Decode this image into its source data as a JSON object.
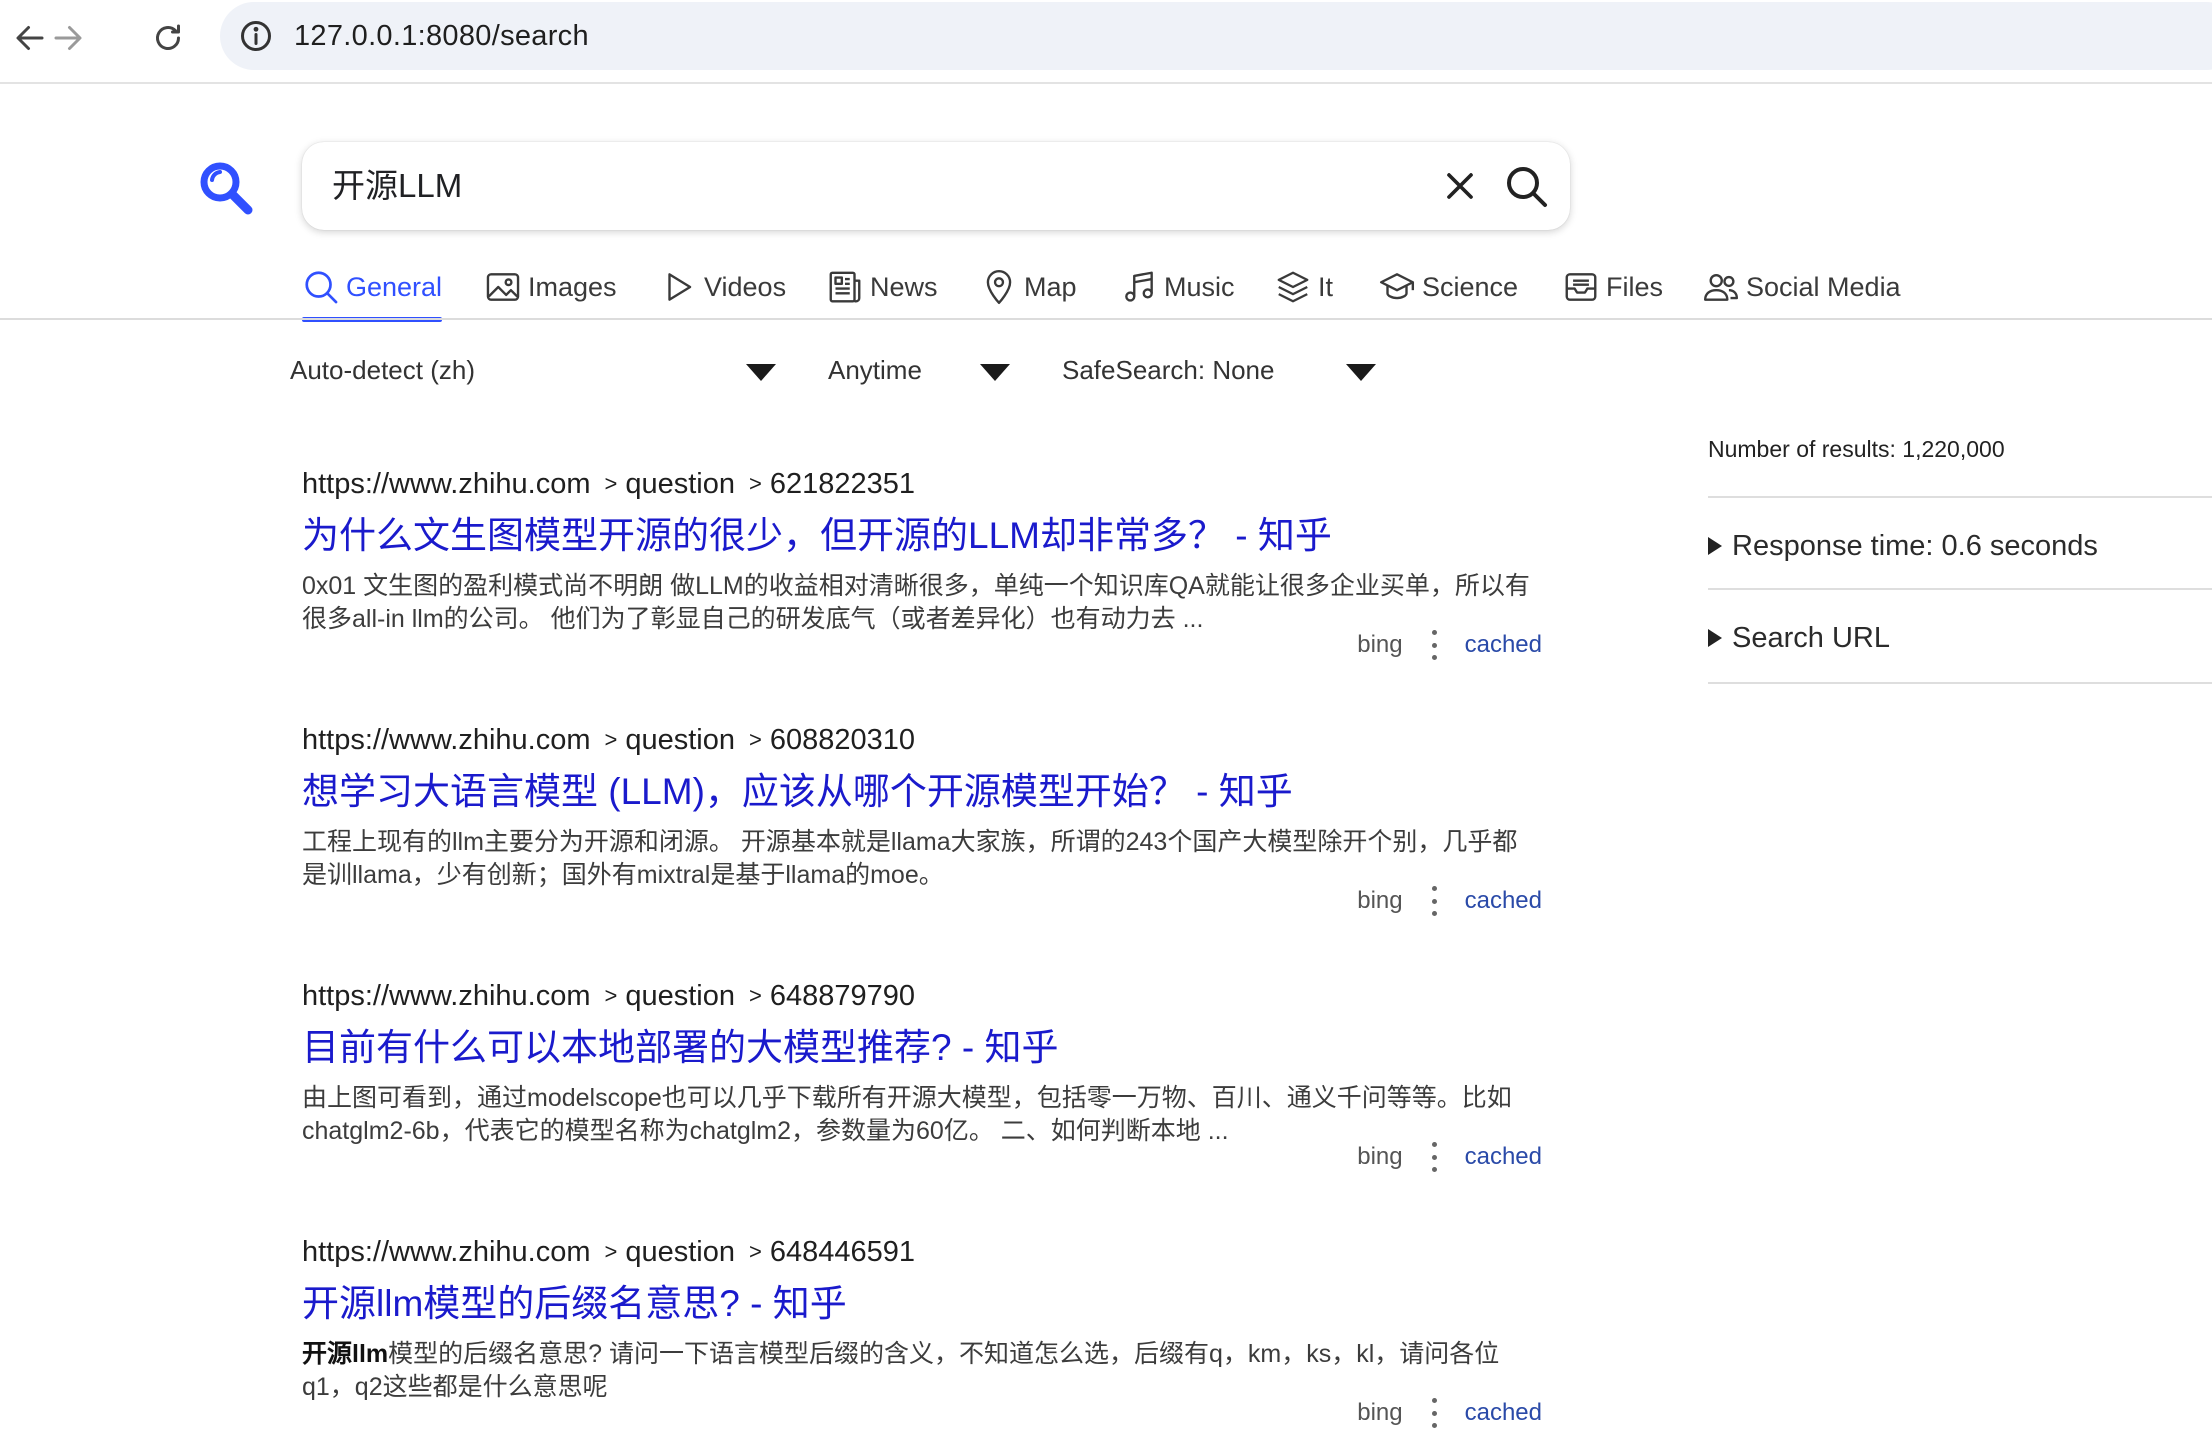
{
  "browser": {
    "url": "127.0.0.1:8080/search"
  },
  "search": {
    "query": "开源LLM"
  },
  "tabs": [
    {
      "label": "General",
      "icon": "search-icon",
      "active": true
    },
    {
      "label": "Images",
      "icon": "image-icon"
    },
    {
      "label": "Videos",
      "icon": "play-icon"
    },
    {
      "label": "News",
      "icon": "newspaper-icon"
    },
    {
      "label": "Map",
      "icon": "map-pin-icon"
    },
    {
      "label": "Music",
      "icon": "music-note-icon"
    },
    {
      "label": "It",
      "icon": "layers-icon"
    },
    {
      "label": "Science",
      "icon": "graduation-cap-icon"
    },
    {
      "label": "Files",
      "icon": "inbox-icon"
    },
    {
      "label": "Social Media",
      "icon": "people-icon"
    }
  ],
  "filters": {
    "language": "Auto-detect (zh)",
    "time": "Anytime",
    "safesearch": "SafeSearch: None"
  },
  "results": [
    {
      "host": "https://www.zhihu.com",
      "path1": "question",
      "path2": "621822351",
      "title": "为什么文生图模型开源的很少，但开源的LLM却非常多？ - 知乎",
      "snippet_bold": "",
      "snippet": "0x01 文生图的盈利模式尚不明朗 做LLM的收益相对清晰很多，单纯一个知识库QA就能让很多企业买单，所以有很多all-in llm的公司。 他们为了彰显自己的研发底气（或者差异化）也有动力去 ...",
      "engine": "bing",
      "cached": "cached"
    },
    {
      "host": "https://www.zhihu.com",
      "path1": "question",
      "path2": "608820310",
      "title": "想学习大语言模型 (LLM)，应该从哪个开源模型开始？ - 知乎",
      "snippet_bold": "",
      "snippet": "工程上现有的llm主要分为开源和闭源。 开源基本就是llama大家族，所谓的243个国产大模型除开个别，几乎都是训llama，少有创新；国外有mixtral是基于llama的moe。",
      "engine": "bing",
      "cached": "cached"
    },
    {
      "host": "https://www.zhihu.com",
      "path1": "question",
      "path2": "648879790",
      "title": "目前有什么可以本地部署的大模型推荐? - 知乎",
      "snippet_bold": "",
      "snippet": "由上图可看到，通过modelscope也可以几乎下载所有开源大模型，包括零一万物、百川、通义千问等等。比如chatglm2-6b，代表它的模型名称为chatglm2，参数量为60亿。 二、如何判断本地 ...",
      "engine": "bing",
      "cached": "cached"
    },
    {
      "host": "https://www.zhihu.com",
      "path1": "question",
      "path2": "648446591",
      "title": "开源llm模型的后缀名意思? - 知乎",
      "snippet_bold": "开源llm",
      "snippet": "模型的后缀名意思? 请问一下语言模型后缀的含义，不知道怎么选，后缀有q，km，ks，kl，请问各位q1，q2这些都是什么意思呢",
      "engine": "bing",
      "cached": "cached"
    }
  ],
  "sidebar": {
    "results_count": "Number of results: 1,220,000",
    "response_time": "Response time: 0.6 seconds",
    "search_url": "Search URL"
  },
  "colors": {
    "accent": "#3050ff",
    "link": "#1a1acc",
    "cached": "#2a4aa8",
    "urlbar_bg": "#eff2f8"
  }
}
